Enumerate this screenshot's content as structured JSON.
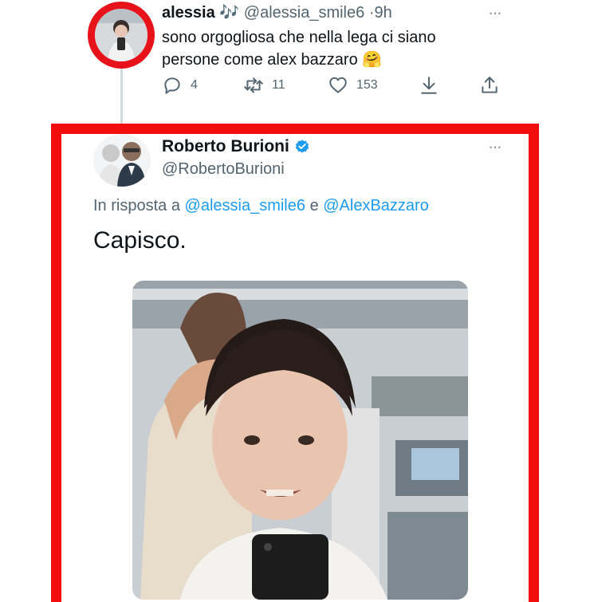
{
  "tweet1": {
    "name": "alessia",
    "name_emoji": "🎶",
    "handle": "@alessia_smile6",
    "separator": "·",
    "time": "9h",
    "text": "sono orgogliosa che nella lega ci siano persone come alex bazzaro 🤗",
    "more_label": "···",
    "actions": {
      "reply_count": "4",
      "retweet_count": "11",
      "like_count": "153"
    }
  },
  "tweet2": {
    "name": "Roberto Burioni",
    "handle": "@RobertoBurioni",
    "more_label": "···",
    "reply_prefix": "In risposta a",
    "reply_user1": "@alessia_smile6",
    "reply_joiner": "e",
    "reply_user2": "@AlexBazzaro",
    "text": "Capisco."
  },
  "colors": {
    "highlight_red": "#f20d0d",
    "link_blue": "#1d9bf0",
    "verified_blue": "#1d9bf0",
    "muted_gray": "#536471"
  },
  "icons": [
    "reply-icon",
    "retweet-icon",
    "like-icon",
    "bookmark-icon",
    "share-icon",
    "verified-badge-icon",
    "more-icon"
  ]
}
